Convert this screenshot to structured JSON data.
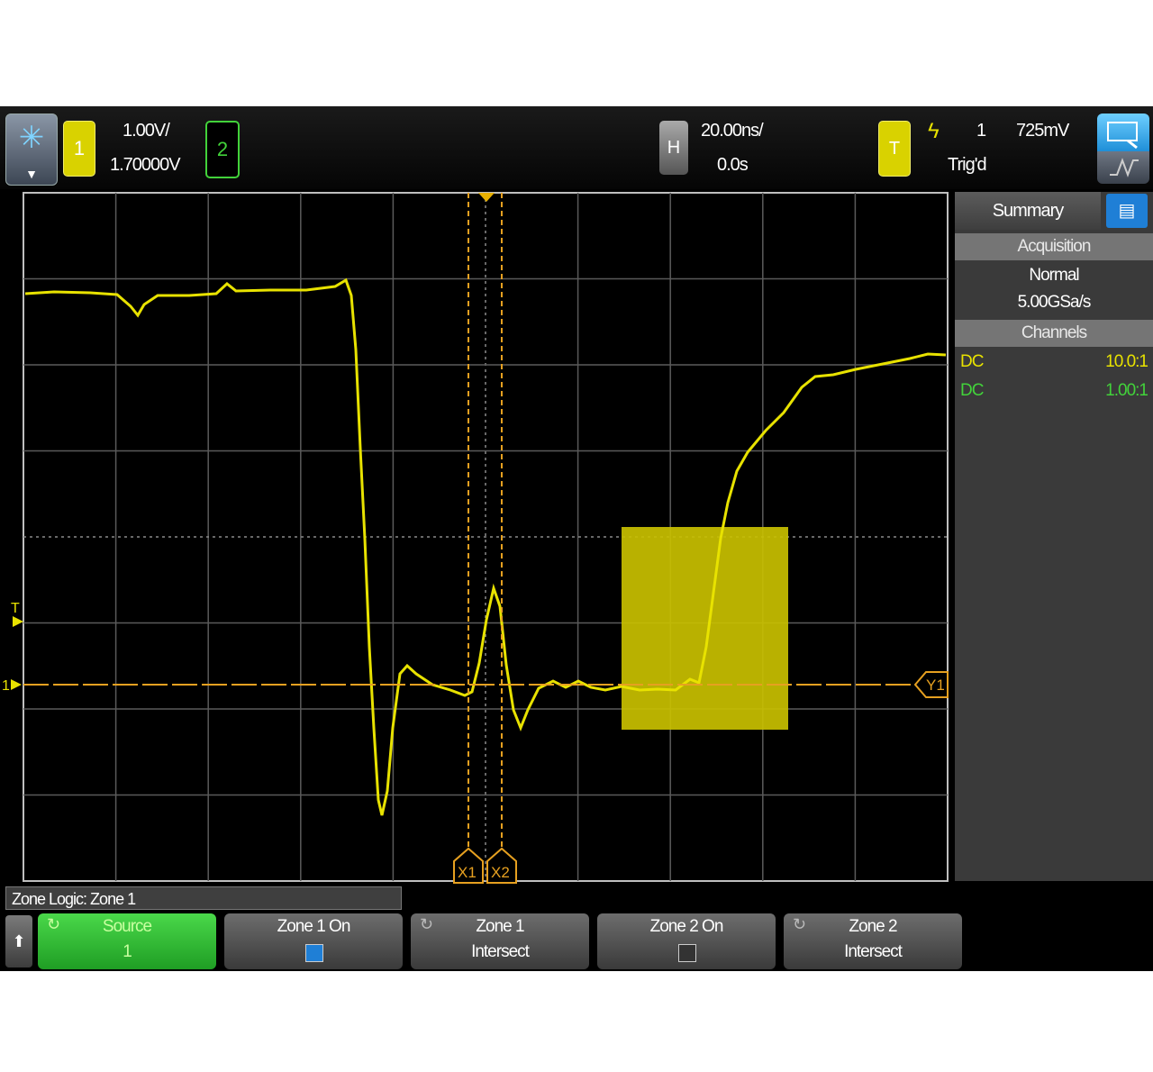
{
  "topbar": {
    "ch1_label": "1",
    "ch1_scale": "1.00V/",
    "ch1_offset": "1.70000V",
    "ch2_label": "2",
    "h_label": "H",
    "time_scale": "20.00ns/",
    "time_delay": "0.0s",
    "t_label": "T",
    "trig_source": "1",
    "trig_level": "725mV",
    "trig_status": "Trig'd"
  },
  "panel": {
    "tab": "Summary",
    "acq_head": "Acquisition",
    "acq_mode": "Normal",
    "acq_rate": "5.00GSa/s",
    "ch_head": "Channels",
    "channels": [
      {
        "coupling": "DC",
        "probe": "10.0:1",
        "color": "#e8e200"
      },
      {
        "coupling": "DC",
        "probe": "1.00:1",
        "color": "#42d23a"
      }
    ]
  },
  "markers": {
    "x1": "X1",
    "x2": "X2",
    "y1": "Y1",
    "trig_marker": "T",
    "ch1_marker": "1"
  },
  "zone_bar": "Zone Logic: Zone 1",
  "softkeys": [
    {
      "line1": "Source",
      "line2": "1"
    },
    {
      "line1": "Zone 1 On",
      "line2": ""
    },
    {
      "line1": "Zone 1",
      "line2": "Intersect"
    },
    {
      "line1": "Zone 2 On",
      "line2": ""
    },
    {
      "line1": "Zone 2",
      "line2": "Intersect"
    }
  ],
  "colors": {
    "ch1": "#e8e200",
    "ch2": "#42d23a",
    "cursor": "#e6a020",
    "zone": "#c9c000",
    "accent": "#1f7fd6"
  }
}
